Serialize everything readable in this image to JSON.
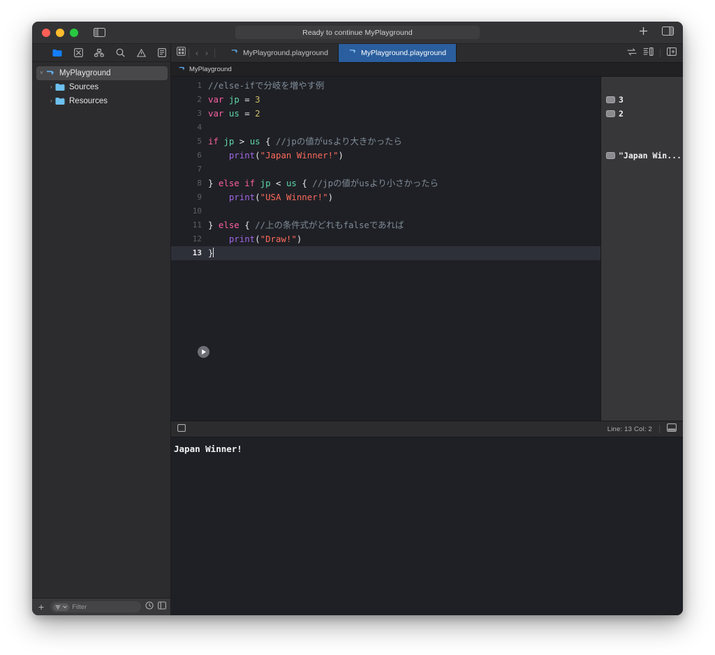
{
  "window": {
    "status_text": "Ready to continue MyPlayground"
  },
  "titlebar": {
    "traffic": [
      "close",
      "minimize",
      "zoom"
    ],
    "sidebar_toggle_icon": "sidebar-toggle-icon",
    "add_icon": "plus-icon",
    "inspector_icon": "inspector-toggle-icon"
  },
  "navigator": {
    "toolbar_icons": [
      "project-folder-icon",
      "source-control-icon",
      "symbol-hierarchy-icon",
      "search-icon",
      "issue-warning-icon",
      "report-document-icon"
    ],
    "tree": [
      {
        "label": "MyPlayground",
        "icon": "playground-icon",
        "disclosure": "˅",
        "depth": 0,
        "selected": true
      },
      {
        "label": "Sources",
        "icon": "folder-icon",
        "disclosure": "›",
        "depth": 1,
        "selected": false
      },
      {
        "label": "Resources",
        "icon": "folder-icon",
        "disclosure": "›",
        "depth": 1,
        "selected": false
      }
    ],
    "filter": {
      "add_label": "+",
      "placeholder": "Filter",
      "recent_icon": "recent-clock-icon",
      "scope_icon": "filter-scope-icon"
    }
  },
  "tabbar": {
    "grid_icon": "tab-overview-icon",
    "back_label": "‹",
    "forward_label": "›",
    "tabs": [
      {
        "label": "MyPlayground.playground",
        "icon": "playground-icon",
        "active": false
      },
      {
        "label": "MyPlayground.playground",
        "icon": "playground-icon",
        "active": true
      }
    ],
    "right_icons": [
      "toggle-code-result-icon",
      "editor-options-icon",
      "add-editor-icon"
    ]
  },
  "jumpbar": {
    "icon": "playground-icon",
    "label": "MyPlayground"
  },
  "editor": {
    "lines": [
      {
        "n": "1",
        "tokens": [
          {
            "t": "com",
            "v": "//else-ifで分岐を増やす例"
          }
        ]
      },
      {
        "n": "2",
        "tokens": [
          {
            "t": "kw",
            "v": "var"
          },
          {
            "t": "pl",
            "v": " "
          },
          {
            "t": "id",
            "v": "jp"
          },
          {
            "t": "pl",
            "v": " = "
          },
          {
            "t": "num",
            "v": "3"
          }
        ]
      },
      {
        "n": "3",
        "tokens": [
          {
            "t": "kw",
            "v": "var"
          },
          {
            "t": "pl",
            "v": " "
          },
          {
            "t": "id",
            "v": "us"
          },
          {
            "t": "pl",
            "v": " = "
          },
          {
            "t": "num",
            "v": "2"
          }
        ]
      },
      {
        "n": "4",
        "tokens": []
      },
      {
        "n": "5",
        "tokens": [
          {
            "t": "kw",
            "v": "if"
          },
          {
            "t": "pl",
            "v": " "
          },
          {
            "t": "id",
            "v": "jp"
          },
          {
            "t": "pl",
            "v": " > "
          },
          {
            "t": "id",
            "v": "us"
          },
          {
            "t": "pl",
            "v": " { "
          },
          {
            "t": "com",
            "v": "//jpの値がusより大きかったら"
          }
        ]
      },
      {
        "n": "6",
        "tokens": [
          {
            "t": "pl",
            "v": "    "
          },
          {
            "t": "fn",
            "v": "print"
          },
          {
            "t": "pl",
            "v": "("
          },
          {
            "t": "str",
            "v": "\"Japan Winner!\""
          },
          {
            "t": "pl",
            "v": ")"
          }
        ]
      },
      {
        "n": "7",
        "tokens": []
      },
      {
        "n": "8",
        "tokens": [
          {
            "t": "pl",
            "v": "} "
          },
          {
            "t": "kw",
            "v": "else"
          },
          {
            "t": "pl",
            "v": " "
          },
          {
            "t": "kw",
            "v": "if"
          },
          {
            "t": "pl",
            "v": " "
          },
          {
            "t": "id",
            "v": "jp"
          },
          {
            "t": "pl",
            "v": " < "
          },
          {
            "t": "id",
            "v": "us"
          },
          {
            "t": "pl",
            "v": " { "
          },
          {
            "t": "com",
            "v": "//jpの値がusより小さかったら"
          }
        ]
      },
      {
        "n": "9",
        "tokens": [
          {
            "t": "pl",
            "v": "    "
          },
          {
            "t": "fn",
            "v": "print"
          },
          {
            "t": "pl",
            "v": "("
          },
          {
            "t": "str",
            "v": "\"USA Winner!\""
          },
          {
            "t": "pl",
            "v": ")"
          }
        ]
      },
      {
        "n": "10",
        "tokens": []
      },
      {
        "n": "11",
        "tokens": [
          {
            "t": "pl",
            "v": "} "
          },
          {
            "t": "kw",
            "v": "else"
          },
          {
            "t": "pl",
            "v": " { "
          },
          {
            "t": "com",
            "v": "//上の条件式がどれもfalseであれば"
          }
        ]
      },
      {
        "n": "12",
        "tokens": [
          {
            "t": "pl",
            "v": "    "
          },
          {
            "t": "fn",
            "v": "print"
          },
          {
            "t": "pl",
            "v": "("
          },
          {
            "t": "str",
            "v": "\"Draw!\""
          },
          {
            "t": "pl",
            "v": ")"
          }
        ]
      },
      {
        "n": "13",
        "tokens": [
          {
            "t": "pl",
            "v": "}"
          }
        ],
        "current": true,
        "caret": true
      }
    ],
    "exec_button_icon": "run-playground-icon"
  },
  "results": [
    {
      "value": "3",
      "line": 2
    },
    {
      "value": "2",
      "line": 3
    },
    {
      "value": "\"Japan Win...",
      "line": 6
    }
  ],
  "debug_bar": {
    "console_toggle_icon": "console-panel-icon",
    "line_col": "Line: 13  Col: 2",
    "show_console_icon": "show-debug-area-icon"
  },
  "console": {
    "lines": [
      "Japan Winner!"
    ]
  },
  "colors": {
    "accent_blue": "#2a5e9e",
    "keyword": "#fc5fa3",
    "identifier": "#5dd8a8",
    "number": "#d0bf69",
    "string": "#fc6a5d",
    "function": "#a167e6",
    "comment": "#7f8c98",
    "editor_bg": "#1f2025",
    "chrome_bg": "#2c2c2e",
    "results_bg": "#37373a"
  }
}
